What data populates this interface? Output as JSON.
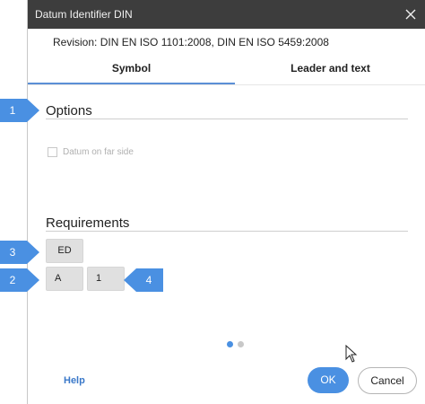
{
  "window": {
    "title": "Datum Identifier DIN",
    "close_glyph": "✕"
  },
  "revision": "Revision: DIN EN ISO 1101:2008, DIN EN ISO 5459:2008",
  "tabs": [
    {
      "label": "Symbol",
      "active": true
    },
    {
      "label": "Leader and text",
      "active": false
    }
  ],
  "options": {
    "title": "Options",
    "datum_far_side": {
      "label": "Datum on far side",
      "checked": false,
      "enabled": false
    }
  },
  "requirements": {
    "title": "Requirements",
    "ed_label": "ED",
    "a_label": "A",
    "one_label": "1"
  },
  "callouts": [
    "1",
    "2",
    "3",
    "4"
  ],
  "pager": {
    "count": 2,
    "active_index": 0
  },
  "footer": {
    "help_label": "Help",
    "ok_label": "OK",
    "cancel_label": "Cancel"
  },
  "colors": {
    "accent": "#4a90e2",
    "titlebar": "#3d3d3d",
    "callout": "#4a90e2"
  }
}
